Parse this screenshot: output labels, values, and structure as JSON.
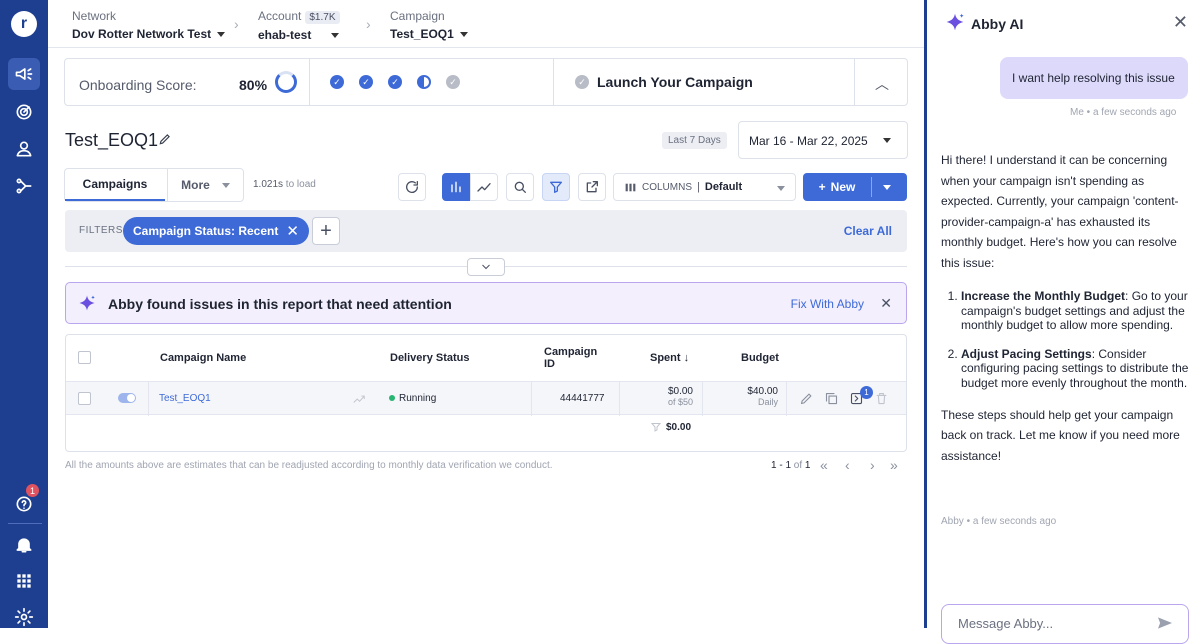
{
  "nav": {
    "logo": "r",
    "help_badge": "1"
  },
  "breadcrumbs": [
    {
      "label": "Network",
      "value": "Dov Rotter Network Test"
    },
    {
      "label": "Account",
      "badge": "$1.7K",
      "value": "ehab-test"
    },
    {
      "label": "Campaign",
      "value": "Test_EOQ1"
    }
  ],
  "onboarding": {
    "title": "Onboarding Score:",
    "percent": "80%",
    "progress_fraction": 0.8,
    "launch_label": "Launch Your Campaign"
  },
  "page": {
    "title": "Test_EOQ1",
    "date_tag": "Last 7 Days",
    "date_range": "Mar 16 - Mar 22, 2025"
  },
  "tabs": {
    "campaigns": "Campaigns",
    "more": "More",
    "load_time": "1.021s",
    "load_suffix": " to load"
  },
  "toolbar": {
    "columns_label": "COLUMNS",
    "columns_value": "Default",
    "new_label": "New"
  },
  "filters": {
    "label": "FILTERS",
    "chip": "Campaign Status: Recent",
    "clear_all": "Clear All"
  },
  "banner": {
    "text": "Abby found issues in this report that need attention",
    "fix": "Fix With Abby"
  },
  "table": {
    "headers": {
      "name": "Campaign Name",
      "status": "Delivery Status",
      "id_line1": "Campaign",
      "id_line2": "ID",
      "spent": "Spent ↓",
      "budget": "Budget"
    },
    "row": {
      "name": "Test_EOQ1",
      "status": "Running",
      "id": "44441777",
      "spent": "$0.00",
      "spent_sub": "of $50",
      "budget": "$40.00",
      "budget_sub": "Daily",
      "action_badge": "1"
    },
    "total_spent": "$0.00"
  },
  "footer": {
    "disclaimer": "All the amounts above are estimates that can be readjusted according to monthly data verification we conduct.",
    "range": "1 - 1",
    "of": " of ",
    "total": "1"
  },
  "abby": {
    "title": "Abby AI",
    "user_message": "I want help resolving this issue",
    "user_meta": "Me • a few seconds ago",
    "intro": "Hi there! I understand it can be concerning when your campaign isn't spending as expected. Currently, your campaign 'content-provider-campaign-a' has exhausted its monthly budget. Here's how you can resolve this issue:",
    "steps": [
      {
        "title": "Increase the Monthly Budget",
        "text": ": Go to your campaign's budget settings and adjust the monthly budget to allow more spending."
      },
      {
        "title": "Adjust Pacing Settings",
        "text": ": Consider configuring pacing settings to distribute the budget more evenly throughout the month."
      }
    ],
    "outro": "These steps should help get your campaign back on track. Let me know if you need more assistance!",
    "bot_meta": "Abby • a few seconds ago",
    "composer_placeholder": "Message Abby..."
  },
  "colors": {
    "sidebar": "#1e3f8f",
    "accent": "#3e6ad8",
    "running": "#27b571",
    "abby_purple": "#b9a6ee"
  },
  "icons": [
    "megaphone-icon",
    "target-icon",
    "user-icon",
    "flow-icon",
    "help-icon",
    "bell-icon",
    "apps-icon",
    "settings-icon",
    "pencil-icon",
    "refresh-icon",
    "bar-chart-icon",
    "line-chart-icon",
    "search-icon",
    "filter-icon",
    "export-icon",
    "columns-icon",
    "sparkle-icon",
    "send-icon"
  ]
}
